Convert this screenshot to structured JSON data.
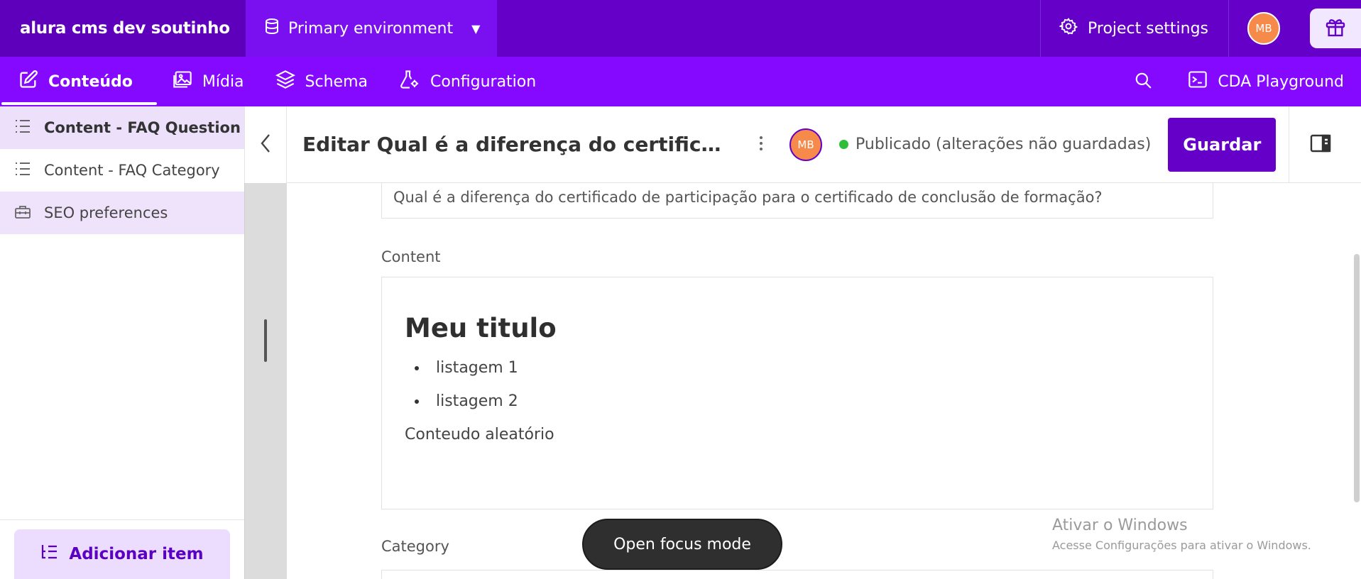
{
  "topbar": {
    "brand": "alura cms dev soutinho",
    "environment": "Primary environment",
    "project_settings": "Project settings",
    "avatar_initials": "MB"
  },
  "nav": {
    "items": [
      {
        "label": "Conteúdo",
        "icon": "edit-icon",
        "active": true
      },
      {
        "label": "Mídia",
        "icon": "image-icon",
        "active": false
      },
      {
        "label": "Schema",
        "icon": "layers-icon",
        "active": false
      },
      {
        "label": "Configuration",
        "icon": "flask-gear-icon",
        "active": false
      }
    ],
    "cda": "CDA Playground"
  },
  "sidebar": {
    "items": [
      {
        "label": "Content - FAQ Question",
        "icon": "list-icon"
      },
      {
        "label": "Content - FAQ Category",
        "icon": "list-icon"
      },
      {
        "label": "SEO preferences",
        "icon": "toolbox-icon"
      }
    ],
    "add_item": "Adicionar item"
  },
  "editor": {
    "title": "Editar Qual é a diferença do certificado de participação para o certificado de conclusão de formação?",
    "avatar_initials": "MB",
    "status": "Publicado (alterações não guardadas)",
    "save_label": "Guardar"
  },
  "fields": {
    "question_value": "Qual é a diferença do certificado de participação para o certificado de conclusão de formação?",
    "content_label": "Content",
    "content": {
      "heading": "Meu titulo",
      "list": [
        "listagem 1",
        "listagem 2"
      ],
      "paragraph": "Conteudo aleatório"
    },
    "category_label": "Category"
  },
  "toast": "Open focus mode",
  "watermark": {
    "line1": "Ativar o Windows",
    "line2": "Acesse Configurações para ativar o Windows."
  },
  "colors": {
    "topbar": "#6500c8",
    "navbar": "#8609ff",
    "accent": "#6500c8",
    "status_green": "#2fbe3a"
  }
}
